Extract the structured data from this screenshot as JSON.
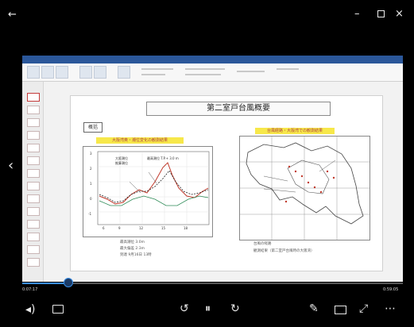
{
  "player": {
    "time_elapsed": "0:07:17",
    "time_total": "0:59:05",
    "progress": 0.12
  },
  "slide": {
    "title": "第二室戸台風概要",
    "section_label": "概括",
    "left_caption": "大阪湾奥・潮位変化の観測結果",
    "right_caption": "台風経路・大阪湾での観測結果",
    "chart_legend": [
      "大阪潮位",
      "推算潮位"
    ],
    "chart_annotation": "最高潮位 T.P.+ 3.0 m",
    "bottom_notes": [
      "最高潮位  3.0m",
      "最大偏差  2.3m",
      "到達  9月16日  13時"
    ],
    "right_notes": [
      "台風の経路",
      "観測結果（第二室戸台風時の大阪湾）"
    ]
  },
  "icons": {
    "back": "back-arrow-icon",
    "minimize": "minimize-icon",
    "maximize": "maximize-icon",
    "close": "close-icon",
    "prev": "chevron-left-icon",
    "volume": "volume-icon",
    "subtitles": "subtitles-icon",
    "rewind": "rewind-icon",
    "pause": "pause-icon",
    "forward": "forward-icon",
    "pen": "pen-icon",
    "screen": "screen-mode-icon",
    "fullscreen": "fullscreen-icon",
    "more": "more-icon"
  },
  "colors": {
    "accent": "#2b579a",
    "progress": "#3a8ee6",
    "highlight": "#f7e84a"
  }
}
